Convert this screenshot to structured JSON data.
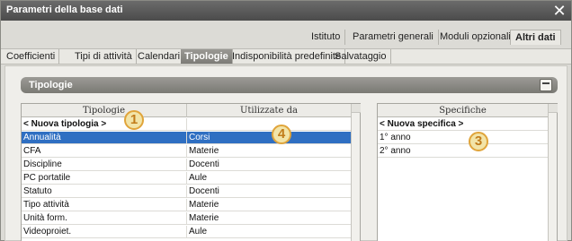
{
  "window": {
    "title": "Parametri della base dati",
    "close_glyph": "✕"
  },
  "tabs_top": [
    {
      "label": "Istituto",
      "active": false
    },
    {
      "label": "Parametri generali",
      "active": false
    },
    {
      "label": "Moduli opzionali",
      "active": false
    },
    {
      "label": "Altri dati",
      "active": true
    }
  ],
  "tabs_bottom": [
    {
      "label": "Coefficienti",
      "active": false
    },
    {
      "label": "Tipi di attività",
      "active": false
    },
    {
      "label": "Calendari",
      "active": false
    },
    {
      "label": "Tipologie",
      "active": true
    },
    {
      "label": "Indisponibilità predefinite",
      "active": false
    },
    {
      "label": "Salvataggio",
      "active": false
    }
  ],
  "section": {
    "title": "Tipologie",
    "tool_icon": "eraser-icon"
  },
  "left_table": {
    "headers": [
      "Tipologie",
      "Utilizzate da"
    ],
    "rows": [
      [
        "< Nuova tipologia >",
        ""
      ],
      [
        "Annualità",
        "Corsi"
      ],
      [
        "CFA",
        "Materie"
      ],
      [
        "Discipline",
        "Docenti"
      ],
      [
        "PC portatile",
        "Aule"
      ],
      [
        "Statuto",
        "Docenti"
      ],
      [
        "Tipo attività",
        "Materie"
      ],
      [
        "Unità form.",
        "Materie"
      ],
      [
        "Videoproiet.",
        "Aule"
      ]
    ],
    "selected_row": 1,
    "bold_row": 0
  },
  "right_table": {
    "header": "Specifiche",
    "rows": [
      "< Nuova specifica >",
      "1° anno",
      "2° anno"
    ],
    "bold_row": 0
  },
  "badges": [
    "1",
    "4",
    "3"
  ],
  "colors": {
    "selection": "#2f6fc2",
    "badge_border": "#e0a43a",
    "badge_fill": "#f2e4a8"
  }
}
